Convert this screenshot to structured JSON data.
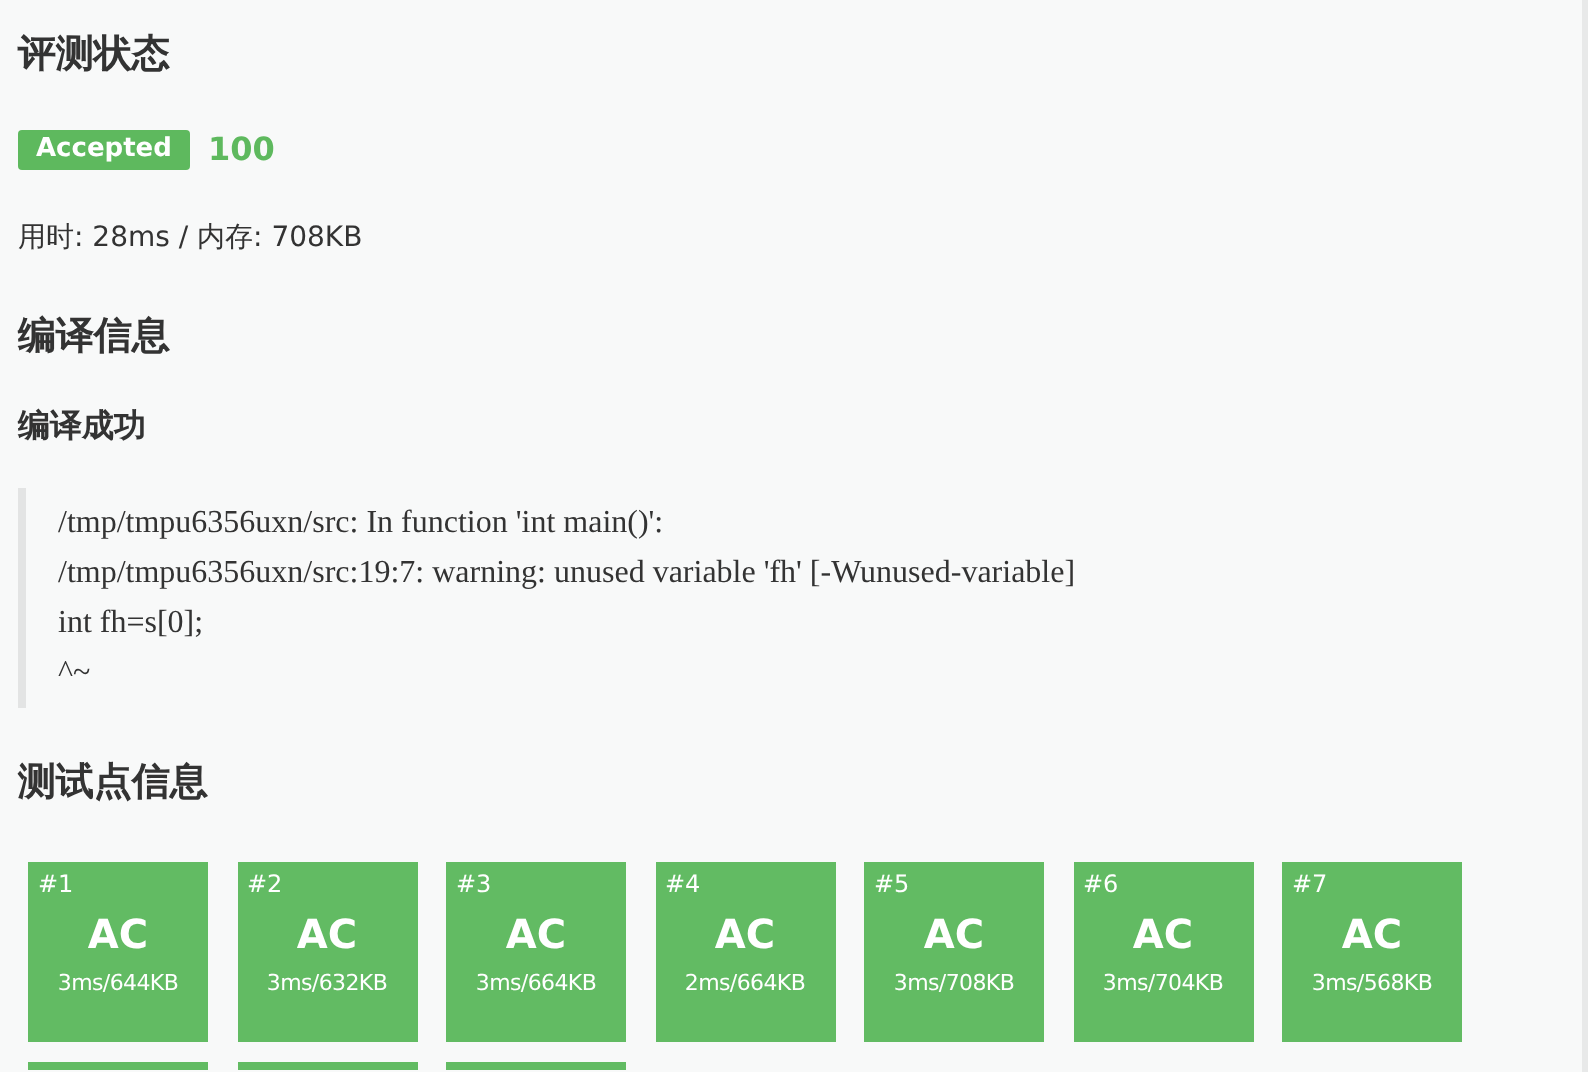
{
  "status_section": {
    "title": "评测状态",
    "badge": {
      "label": "Accepted",
      "kind": "accepted"
    },
    "score": "100",
    "usage": "用时: 28ms / 内存: 708KB"
  },
  "compile_section": {
    "title": "编译信息",
    "result": "编译成功",
    "output": [
      "/tmp/tmpu6356uxn/src: In function 'int main()':",
      "/tmp/tmpu6356uxn/src:19:7: warning: unused variable 'fh' [-Wunused-variable]",
      "int fh=s[0];",
      "^~"
    ]
  },
  "tests_section": {
    "title": "测试点信息",
    "testcases": [
      {
        "kind": "full",
        "status": "AC",
        "number": "#1",
        "usage": "3ms/644KB"
      },
      {
        "kind": "full",
        "status": "AC",
        "number": "#2",
        "usage": "3ms/632KB"
      },
      {
        "kind": "full",
        "status": "AC",
        "number": "#3",
        "usage": "3ms/664KB"
      },
      {
        "kind": "full",
        "status": "AC",
        "number": "#4",
        "usage": "2ms/664KB"
      },
      {
        "kind": "full",
        "status": "AC",
        "number": "#5",
        "usage": "3ms/708KB"
      },
      {
        "kind": "full",
        "status": "AC",
        "number": "#6",
        "usage": "3ms/704KB"
      },
      {
        "kind": "full",
        "status": "AC",
        "number": "#7",
        "usage": "3ms/568KB"
      },
      {
        "kind": "cut-off",
        "color": "#62bb63"
      },
      {
        "kind": "cut-off",
        "color": "#62bb63"
      },
      {
        "kind": "cut-off",
        "color": "#62bb63"
      }
    ]
  }
}
